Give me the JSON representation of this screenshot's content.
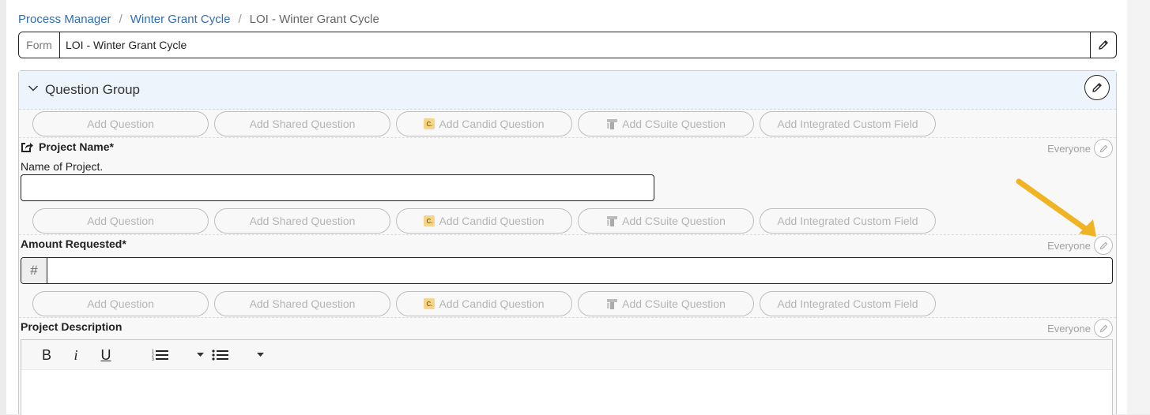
{
  "breadcrumb": {
    "items": [
      "Process Manager",
      "Winter Grant Cycle"
    ],
    "current": "LOI - Winter Grant Cycle",
    "separator": "/"
  },
  "form": {
    "prefix_label": "Form",
    "value": "LOI - Winter Grant Cycle"
  },
  "group": {
    "title": "Question Group"
  },
  "add_buttons": {
    "add_question": "Add Question",
    "add_shared_question": "Add Shared Question",
    "candid_badge": "C.",
    "add_candid_question": "Add Candid Question",
    "add_csuite_question": "Add CSuite Question",
    "add_integrated_custom_field": "Add Integrated Custom Field"
  },
  "questions": [
    {
      "label": "Project Name*",
      "help_text": "Name of Project.",
      "audience": "Everyone",
      "icon": "external-share-icon"
    },
    {
      "label": "Amount Requested*",
      "audience": "Everyone",
      "input_prefix": "#"
    },
    {
      "label": "Project Description",
      "audience": "Everyone"
    }
  ],
  "editor_toolbar": {
    "bold": "B",
    "italic": "i",
    "underline": "U"
  },
  "colors": {
    "link": "#2f6db5",
    "group_header_bg": "#eef4fb",
    "arrow": "#f0b323",
    "candid_badge": "#f6d58a"
  }
}
